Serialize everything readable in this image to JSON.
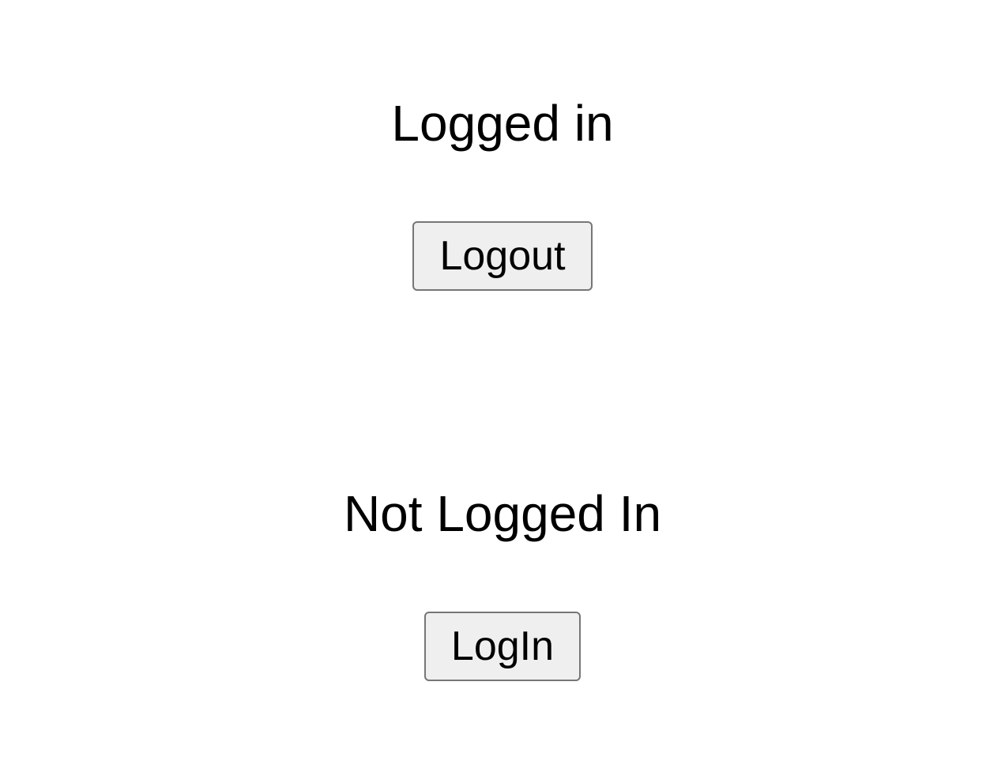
{
  "logged_in": {
    "status_text": "Logged in",
    "button_label": "Logout"
  },
  "not_logged_in": {
    "status_text": "Not Logged In",
    "button_label": "LogIn"
  },
  "colors": {
    "background": "#ffffff",
    "text": "#000000",
    "button_background": "#efefef",
    "button_border": "#767676"
  }
}
